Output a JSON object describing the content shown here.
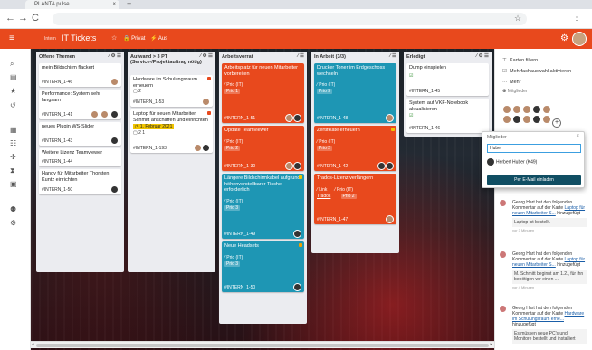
{
  "browser": {
    "tab_title": "PLANTA pulse",
    "tab_close": "×",
    "new_tab": "+",
    "back": "←",
    "forward": "→",
    "reload": "C",
    "star": "☆",
    "menu": "⋮"
  },
  "app": {
    "menu_icon": "≡",
    "crumb": "Intern",
    "board_title": "IT Tickets",
    "privat": "Privat",
    "aus": "Aus",
    "accent": "#e8491d"
  },
  "lists": [
    {
      "title": "Offene Themen",
      "cards": [
        {
          "title": "mein Bildschirm flackert",
          "id": "#INTERN_1-46"
        },
        {
          "title": "Performance: System sehr langsam",
          "id": "#INTERN_1-41"
        },
        {
          "title": "neues Plugin WS-Slider",
          "id": "#INTERN_1-43"
        },
        {
          "title": "Weitere Lizenz Teamviewer",
          "id": "#INTERN_1-44"
        },
        {
          "title": "Handy für Mitarbeiter Thorsten Kuntz einrichten",
          "id": "#INTERN_1-50"
        }
      ]
    },
    {
      "title": "Aufwand > 3 PT (Service-/Projektauftrag nötig)",
      "cards": [
        {
          "title": "Hardware im Schulungsraum erneuern",
          "meta": "2",
          "id": "#INTERN_1-53"
        },
        {
          "title": "Laptop für neuen Mitarbeiter Schmitt anschaffen und einrichten",
          "date": "1. Februar 2021",
          "meta": "2  1",
          "id": "#INTERN_1-193"
        }
      ]
    },
    {
      "title": "Arbeitsvorrat",
      "cards": [
        {
          "title": "Arbeitsplatz für neuen Mitarbeiter vorbereiten",
          "prio_label": "Prio (IT)",
          "prio": "Prio 1",
          "id": "#INTERN_1-51",
          "color": "#e8491d"
        },
        {
          "title": "Update Teamviewer",
          "prio_label": "Prio (IT)",
          "prio": "Prio 2",
          "id": "#INTERN_1-30",
          "color": "#e8491d"
        },
        {
          "title": "Längere Bildschirmkabel aufgrund höhenverstellbarer Tische erforderlich",
          "prio_label": "Prio (IT)",
          "prio": "Prio 3",
          "id": "#INTERN_1-49",
          "color": "#1e96b4"
        },
        {
          "title": "Neue Headsets",
          "prio_label": "Prio (IT)",
          "prio": "Prio 3",
          "id": "#INTERN_1-50",
          "color": "#1e96b4"
        }
      ]
    },
    {
      "title": "In Arbeit  (3/3)",
      "cards": [
        {
          "title": "Drucker Toner im Erdgeschoss wechseln",
          "prio_label": "Prio (IT)",
          "prio": "Prio 3",
          "id": "#INTERN_1-48",
          "color": "#1e96b4"
        },
        {
          "title": "Zertifikate erneuern",
          "prio_label": "Prio (IT)",
          "prio": "Prio 2",
          "id": "#INTERN_1-42",
          "color": "#e8491d"
        },
        {
          "title": "Trados-Lizenz verlängern",
          "prio_label": "Link",
          "link": "Trados",
          "prio_label2": "Prio (IT)",
          "prio": "Prio 2",
          "id": "#INTERN_1-47",
          "color": "#e8491d"
        }
      ]
    },
    {
      "title": "Erledigt",
      "cards": [
        {
          "title": "Dump einspielen",
          "id": "#INTERN_1-45"
        },
        {
          "title": "System auf VKF-Notebook aktualisieren",
          "id": "#INTERN_1-46"
        }
      ]
    }
  ],
  "right_panel": {
    "filter": "Karten filtern",
    "multi": "Mehrfachauswahl aktivieren",
    "more": "Mehr",
    "members_title": "Mitglieder",
    "add": "+"
  },
  "popup": {
    "title": "Mitglieder",
    "close": "×",
    "input_value": "Huber",
    "result": "Herbert Huber (K49)",
    "button": "Per E-Mail einladen"
  },
  "activity": [
    {
      "text": "Georg Hart hat den folgenden Kommentar auf der Karte ",
      "link": "Laptop für neuen Mitarbeiter S...",
      "suffix": " hinzugefügt",
      "comment": "Laptop ist bestellt.",
      "time": "vor 3 Minuten"
    },
    {
      "text": "Georg Hart hat den folgenden Kommentar auf der Karte ",
      "link": "Laptop für neuen Mitarbeiter S...",
      "suffix": " hinzugefügt",
      "comment": "M. Schmitt beginnt am 1.2., für ihn benötigen wir einen ...",
      "time": "vor 4 Minuten"
    },
    {
      "text": "Georg Hart hat den folgenden Kommentar auf der Karte ",
      "link": "Hardware im Schulungsraum erne...",
      "suffix": " hinzugefügt",
      "comment": "Es müssen neue PC's und Monitore bestellt und installiert",
      "time": ""
    }
  ]
}
